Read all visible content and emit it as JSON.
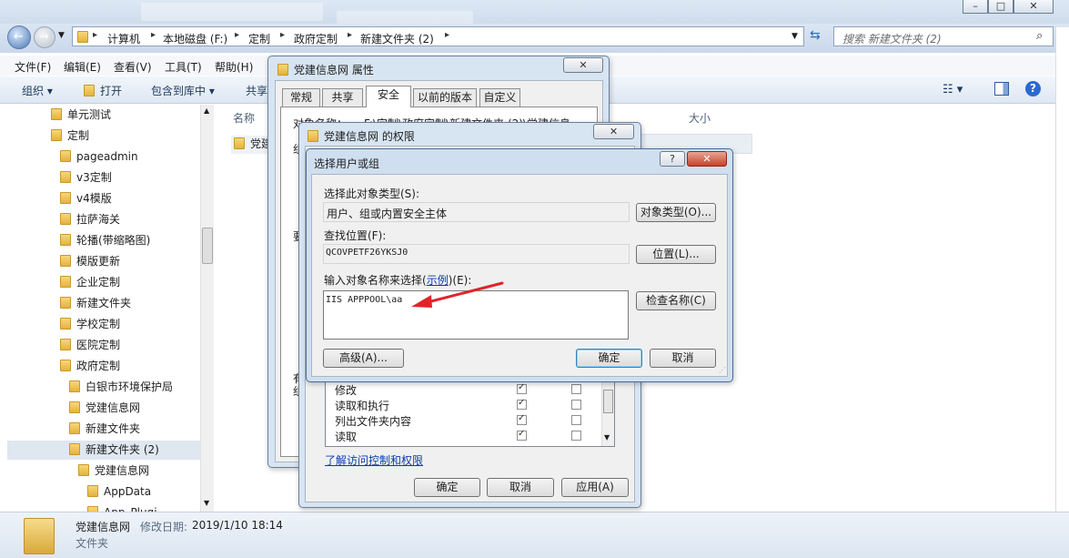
{
  "colors": {
    "accent": "#3c7fb1",
    "link": "#0b3dae",
    "arrow": "#e0252b"
  },
  "address": {
    "crumbs": [
      "计算机",
      "本地磁盘 (F:)",
      "定制",
      "政府定制",
      "新建文件夹 (2)"
    ],
    "search_placeholder": "搜索 新建文件夹 (2)"
  },
  "menu": [
    "文件(F)",
    "编辑(E)",
    "查看(V)",
    "工具(T)",
    "帮助(H)"
  ],
  "toolbar": {
    "organize": "组织",
    "open": "打开",
    "include": "包含到库中",
    "share": "共享"
  },
  "columns": {
    "name": "名称",
    "size": "大小"
  },
  "file_item": "党建",
  "tree": [
    "单元测试",
    "定制",
    "pageadmin",
    "v3定制",
    "v4模版",
    "拉萨海关",
    "轮播(带缩略图)",
    "模版更新",
    "企业定制",
    "新建文件夹",
    "学校定制",
    "医院定制",
    "政府定制",
    "白银市环境保护局",
    "党建信息网",
    "新建文件夹",
    "新建文件夹 (2)",
    "党建信息网",
    "AppData",
    "App_Plugi"
  ],
  "details": {
    "name": "党建信息网",
    "modified_label": "修改日期:",
    "modified": "2019/1/10 18:14",
    "type": "文件夹"
  },
  "props": {
    "title": "党建信息网 属性",
    "tabs": [
      "常规",
      "共享",
      "安全",
      "以前的版本",
      "自定义"
    ],
    "object_name_label": "对象名称：",
    "object_name": "F:\\定制\\政府定制\\新建文件夹 (2)\\党建信息",
    "frag1": "组",
    "frag2": "要",
    "frag3": "有",
    "frag4": "组"
  },
  "perms": {
    "title": "党建信息网 的权限",
    "rows": [
      {
        "label": "修改",
        "allow": true,
        "deny": false
      },
      {
        "label": "读取和执行",
        "allow": true,
        "deny": false
      },
      {
        "label": "列出文件夹内容",
        "allow": true,
        "deny": false
      },
      {
        "label": "读取",
        "allow": true,
        "deny": false
      }
    ],
    "learn_link": "了解访问控制和权限",
    "ok": "确定",
    "cancel": "取消",
    "apply": "应用(A)"
  },
  "select_user": {
    "title": "选择用户或组",
    "help": "?",
    "object_type_label": "选择此对象类型(S):",
    "object_type_value": "用户、组或内置安全主体",
    "object_type_btn": "对象类型(O)...",
    "location_label": "查找位置(F):",
    "location_value": "QCOVPETF26YKSJ0",
    "location_btn": "位置(L)...",
    "enter_label_pre": "输入对象名称来选择(",
    "enter_label_link": "示例",
    "enter_label_post": ")(E):",
    "enter_value": "IIS APPPOOL\\aa",
    "check_btn": "检查名称(C)",
    "advanced_btn": "高级(A)...",
    "ok": "确定",
    "cancel": "取消"
  }
}
